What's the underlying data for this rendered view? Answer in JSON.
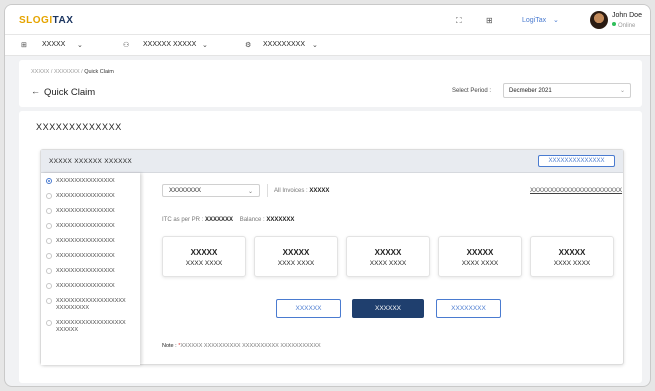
{
  "app": {
    "logo_prefix": "S",
    "logo_mid": "LOGI",
    "logo_suffix": "TAX"
  },
  "topbar": {
    "icons": [
      "expand-icon",
      "grid-icon"
    ],
    "product_label": "LogiTax",
    "user_name": "John Doe",
    "user_status": "Online"
  },
  "menu": {
    "items": [
      {
        "icon": "grid-icon",
        "label": "XXXXX"
      },
      {
        "icon": "users-icon",
        "label": "XXXXXX XXXXX"
      },
      {
        "icon": "settings-icon",
        "label": "XXXXXXXXX"
      }
    ]
  },
  "header": {
    "breadcrumb": [
      "XXXXX",
      "XXXXXXX",
      "Quick Claim"
    ],
    "title": "Quick Claim",
    "period_label": "Select Period :",
    "period_value": "Decmeber 2021"
  },
  "main": {
    "title": "XXXXXXXXXXXXX",
    "card_title": "XXXXX XXXXXX XXXXXX",
    "card_action": "XXXXXXXXXXXXXX",
    "radio_options": [
      "XXXXXXXXXXXXXXXX",
      "XXXXXXXXXXXXXXXX",
      "XXXXXXXXXXXXXXXX",
      "XXXXXXXXXXXXXXXX",
      "XXXXXXXXXXXXXXXX",
      "XXXXXXXXXXXXXXXX",
      "XXXXXXXXXXXXXXXX",
      "XXXXXXXXXXXXXXXX",
      "XXXXXXXXXXXXXXXXXXXXXXXXXXXX",
      "XXXXXXXXXXXXXXXXXXXXXXXXX"
    ],
    "selected_option_index": 0,
    "dropdown_value": "XXXXXXXX",
    "invoices_label": "All Invoices :",
    "invoices_value": "XXXXX",
    "right_link": "XXXXXXXXXXXXXXXXXXXXXXX",
    "itc_label": "ITC as per PR :",
    "itc_value": "XXXXXXX",
    "balance_label": "Balance :",
    "balance_value": "XXXXXXX",
    "tiles": [
      {
        "title": "XXXXX",
        "subtitle": "XXXX XXXX"
      },
      {
        "title": "XXXXX",
        "subtitle": "XXXX XXXX"
      },
      {
        "title": "XXXXX",
        "subtitle": "XXXX XXXX"
      },
      {
        "title": "XXXXX",
        "subtitle": "XXXX XXXX"
      },
      {
        "title": "XXXXX",
        "subtitle": "XXXX XXXX"
      }
    ],
    "buttons": {
      "left": "XXXXXX",
      "primary": "XXXXXX",
      "right": "XXXXXXXX"
    },
    "note_label": "Note :",
    "note_text": "XXXXXX XXXXXXXXXX  XXXXXXXXXX  XXXXXXXXXXX"
  },
  "colors": {
    "accent": "#4a7bd0",
    "primary_button": "#1f3f6e",
    "logo_gold": "#e5a400",
    "logo_navy": "#1b3560"
  }
}
